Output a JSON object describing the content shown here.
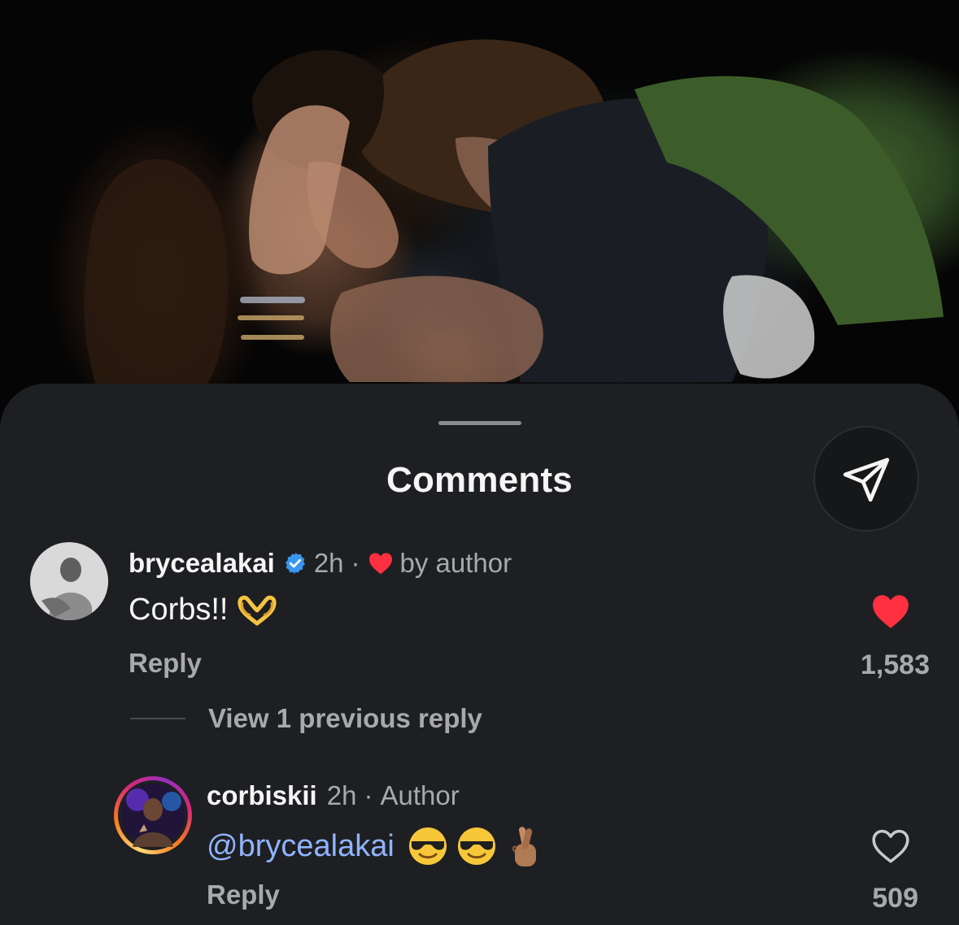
{
  "sheet": {
    "title": "Comments",
    "share_icon": "paper-plane-icon"
  },
  "comments": [
    {
      "username": "brycealakai",
      "verified": true,
      "time": "2h",
      "separator": "·",
      "liked_by_author_label": "by author",
      "text": "Corbs!!",
      "emoji": [
        "heart-hands"
      ],
      "reply_label": "Reply",
      "liked": true,
      "like_count": "1,583"
    }
  ],
  "thread": {
    "view_replies_label": "View 1 previous reply"
  },
  "replies": [
    {
      "username": "corbiskii",
      "time": "2h",
      "separator": "·",
      "role_label": "Author",
      "mention": "@brycealakai",
      "emoji": [
        "sunglasses-face",
        "sunglasses-face",
        "crossed-fingers"
      ],
      "reply_label": "Reply",
      "liked": false,
      "like_count": "509",
      "has_story_ring": true
    }
  ],
  "colors": {
    "sheet_bg": "#1e1f22",
    "like_red": "#ff3040",
    "verified_blue": "#3897f0",
    "mention_blue": "#8fb4ff"
  }
}
